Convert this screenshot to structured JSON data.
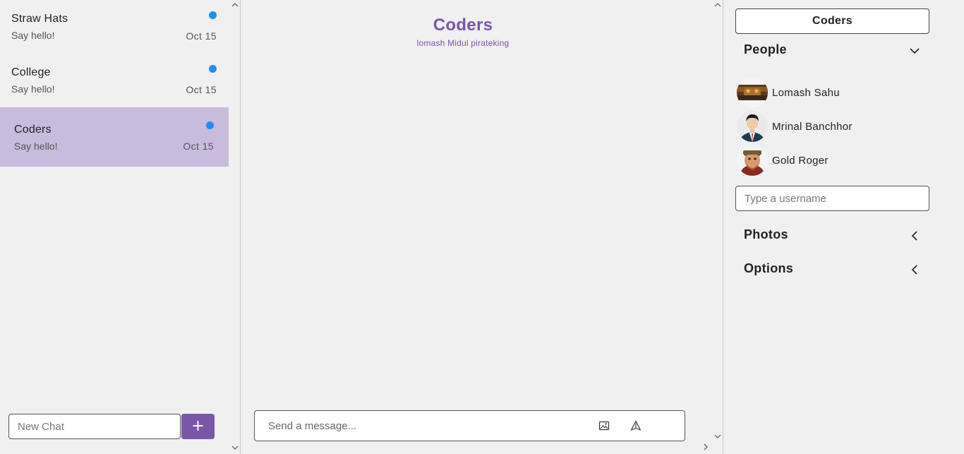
{
  "chat_list": {
    "items": [
      {
        "title": "Straw Hats",
        "subtitle": "Say hello!",
        "date": "Oct 15",
        "unread": true
      },
      {
        "title": "College",
        "subtitle": "Say hello!",
        "date": "Oct 15",
        "unread": true
      },
      {
        "title": "Coders",
        "subtitle": "Say hello!",
        "date": "Oct 15",
        "unread": true,
        "active": true
      }
    ],
    "new_chat_placeholder": "New Chat",
    "add_label": "+"
  },
  "chat_header": {
    "title": "Coders",
    "members": "lomash Midul pirateking"
  },
  "composer": {
    "placeholder": "Send a message...",
    "image_icon": "image-icon",
    "send_icon": "send-icon"
  },
  "settings": {
    "chat_name": "Coders",
    "people_label": "People",
    "people": [
      {
        "name": "Lomash Sahu",
        "status": "offline"
      },
      {
        "name": "Mrinal Banchhor",
        "status": "offline"
      },
      {
        "name": "Gold Roger",
        "status": "online"
      }
    ],
    "username_placeholder": "Type a username",
    "photos_label": "Photos",
    "options_label": "Options"
  },
  "colors": {
    "accent": "#7a56a8",
    "active_chat_bg": "#c8bcdc",
    "unread_dot": "#1e8ff0",
    "online": "#22aa22",
    "offline": "#dd2222"
  }
}
